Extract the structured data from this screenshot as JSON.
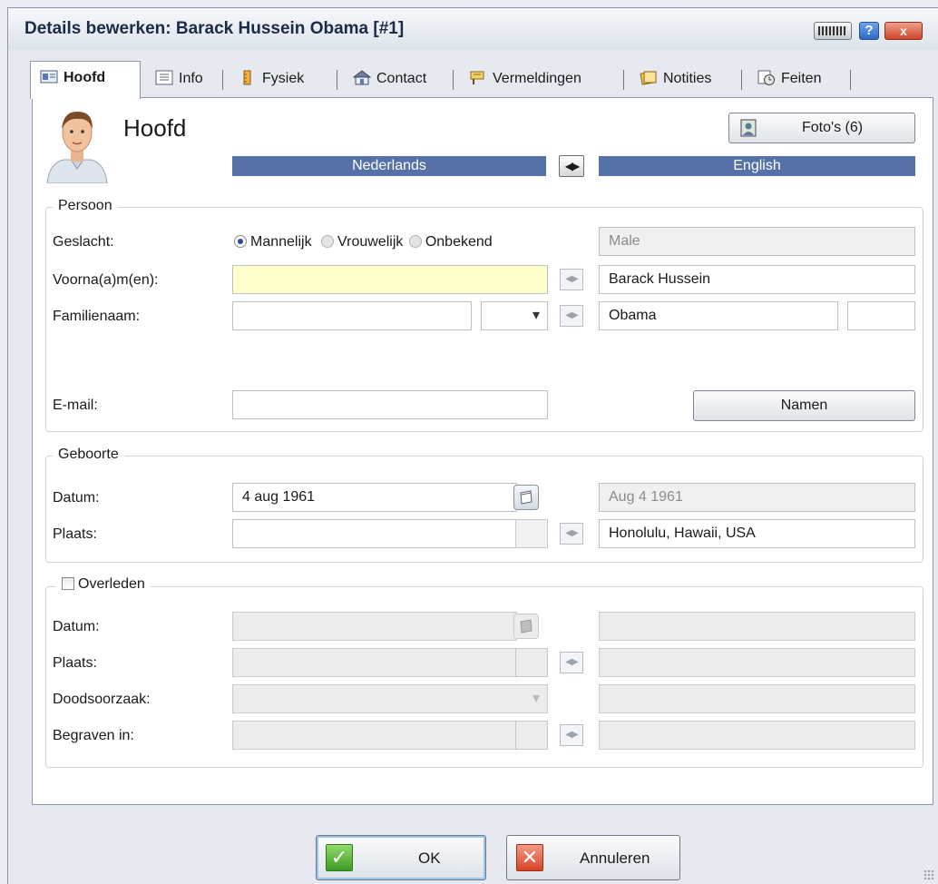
{
  "window": {
    "title": "Details bewerken: Barack Hussein Obama [#1]",
    "help_label": "?",
    "close_label": "x"
  },
  "tabs": [
    {
      "label": "Hoofd",
      "icon": "id-card-icon",
      "active": true
    },
    {
      "label": "Info",
      "icon": "info-list-icon",
      "active": false
    },
    {
      "label": "Fysiek",
      "icon": "ruler-icon",
      "active": false
    },
    {
      "label": "Contact",
      "icon": "house-icon",
      "active": false
    },
    {
      "label": "Vermeldingen",
      "icon": "sign-icon",
      "active": false
    },
    {
      "label": "Notities",
      "icon": "notes-icon",
      "active": false
    },
    {
      "label": "Feiten",
      "icon": "fact-clock-icon",
      "active": false
    }
  ],
  "header": {
    "heading": "Hoofd",
    "photos_label": "Foto's (6)",
    "lang_left": "Nederlands",
    "lang_right": "English"
  },
  "persoon": {
    "legend": "Persoon",
    "gender_label": "Geslacht:",
    "gender_options": [
      "Mannelijk",
      "Vrouwelijk",
      "Onbekend"
    ],
    "gender_selected": "Mannelijk",
    "gender_en": "Male",
    "firstnames_label": "Voorna(a)m(en):",
    "firstnames_value": "",
    "firstnames_en": "Barack Hussein",
    "lastname_label": "Familienaam:",
    "lastname_value": "",
    "lastname_en": "Obama",
    "email_label": "E-mail:",
    "email_value": "",
    "names_button": "Namen"
  },
  "geboorte": {
    "legend": "Geboorte",
    "date_label": "Datum:",
    "date_value": "4 aug 1961",
    "date_en": "Aug 4 1961",
    "place_label": "Plaats:",
    "place_value": "",
    "place_en": "Honolulu, Hawaii, USA"
  },
  "overleden": {
    "legend": "Overleden",
    "checked": false,
    "date_label": "Datum:",
    "place_label": "Plaats:",
    "cause_label": "Doodsoorzaak:",
    "buried_label": "Begraven in:"
  },
  "footer": {
    "ok_label": "OK",
    "cancel_label": "Annuleren"
  },
  "colors": {
    "lang_bar": "#5671a8",
    "highlight_field": "#ffffcc",
    "ok_icon": "#3f9c24",
    "cancel_icon": "#d8432a"
  }
}
